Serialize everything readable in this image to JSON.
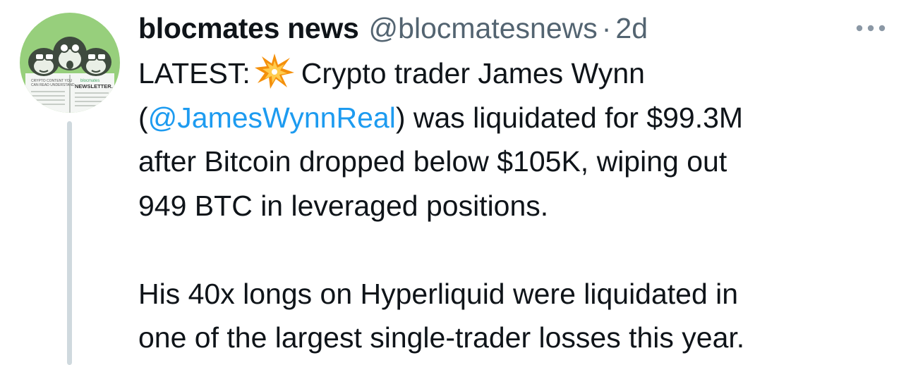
{
  "tweet": {
    "author": {
      "display_name": "blocmates news",
      "handle": "@blocmatesnews",
      "separator": "·",
      "time": "2d",
      "avatar_text_1": "blocmates",
      "avatar_text_2": "NEWSLETTER."
    },
    "menu_icon": "more-horizontal-icon",
    "emoji_icon": "collision-emoji-icon",
    "body": {
      "p1_l1_pre": "LATEST:",
      "p1_l1_post": "Crypto trader James Wynn",
      "p1_l2_open": "(",
      "p1_l2_mention": "@JamesWynnReal",
      "p1_l2_post": ") was liquidated for $99.3M",
      "p1_l3": "after Bitcoin dropped below $105K, wiping out",
      "p1_l4": "949 BTC in leveraged positions.",
      "p2_l1": "His 40x longs on Hyperliquid were liquidated in",
      "p2_l2": "one of the largest single-trader losses this year."
    },
    "colors": {
      "text": "#0f1419",
      "secondary": "#536471",
      "link": "#1d9bf0",
      "avatar_bg": "#97cf7c",
      "thread_line": "#cfd9de"
    }
  }
}
